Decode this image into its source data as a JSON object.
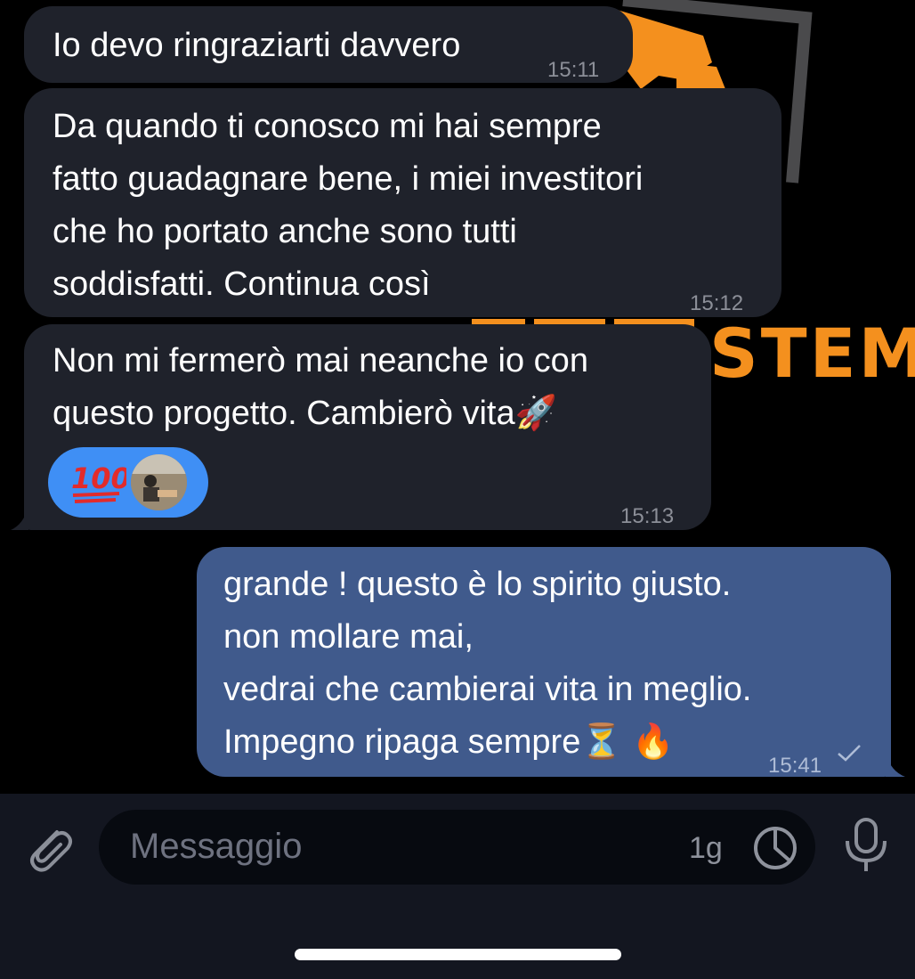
{
  "wallpaper": {
    "brand_text": "STEM"
  },
  "messages": [
    {
      "direction": "incoming",
      "text": "Io devo ringraziarti davvero",
      "time": "15:11"
    },
    {
      "direction": "incoming",
      "text": "Da quando ti conosco mi hai sempre\nfatto guadagnare bene, i miei investitori\nche ho portato anche sono tutti\nsoddisfatti. Continua così",
      "time": "15:12"
    },
    {
      "direction": "incoming",
      "text": "Non mi fermerò mai neanche io con\nquesto progetto. Cambierò vita🚀",
      "time": "15:13",
      "reaction": {
        "emoji": "💯",
        "name": "hundred-points-icon"
      }
    },
    {
      "direction": "outgoing",
      "text": "grande ! questo è lo spirito giusto.\nnon mollare mai,\nvedrai che cambierai vita in meglio.\nImpegno ripaga sempre⏳ 🔥",
      "time": "15:41",
      "status": "sent"
    }
  ],
  "composer": {
    "placeholder": "Messaggio",
    "timer_label": "1g",
    "icons": [
      "paperclip-icon",
      "timer-icon",
      "microphone-icon"
    ]
  },
  "colors": {
    "background": "#000000",
    "incoming_bubble": "#1f222b",
    "outgoing_bubble": "#405a8c",
    "reaction_pill": "#3f8ff5",
    "wallpaper_accent": "#f4901e",
    "composer_bar": "#131620"
  }
}
